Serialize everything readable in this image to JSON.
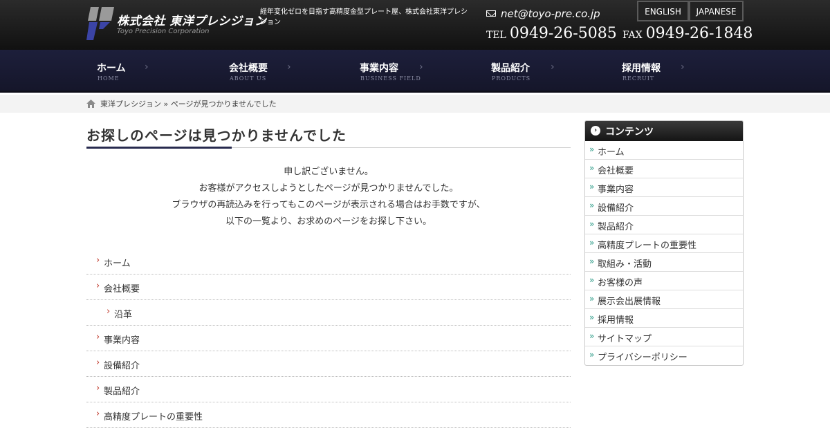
{
  "header": {
    "company_name": "株式会社 東洋プレシジョン",
    "company_name_en": "Toyo Precision Corporation",
    "tagline": "経年変化ゼロを目指す高精度金型プレート屋、株式会社東洋プレシジョン",
    "email": "net@toyo-pre.co.jp",
    "tel_label": "TEL",
    "tel": "0949-26-5085",
    "fax_label": "FAX",
    "fax": "0949-26-1848",
    "lang_en": "ENGLISH",
    "lang_ja": "JAPANESE"
  },
  "nav": [
    {
      "jp": "ホーム",
      "en": "HOME"
    },
    {
      "jp": "会社概要",
      "en": "ABOUT US"
    },
    {
      "jp": "事業内容",
      "en": "BUSINESS FIELD"
    },
    {
      "jp": "製品紹介",
      "en": "PRODUCTS"
    },
    {
      "jp": "採用情報",
      "en": "RECRUIT"
    }
  ],
  "breadcrumb": "東洋プレシジョン » ページが見つかりませんでした",
  "main": {
    "title": "お探しのページは見つかりませんでした",
    "message": [
      "申し訳ございません。",
      "お客様がアクセスしようとしたページが見つかりませんでした。",
      "ブラウザの再読込みを行ってもこのページが表示される場合はお手数ですが、",
      "以下の一覧より、お求めのページをお探し下さい。"
    ],
    "links": [
      "ホーム",
      "会社概要",
      "沿革",
      "事業内容",
      "設備紹介",
      "製品紹介",
      "高精度プレートの重要性"
    ]
  },
  "sidebar": {
    "title": "コンテンツ",
    "items": [
      "ホーム",
      "会社概要",
      "事業内容",
      "設備紹介",
      "製品紹介",
      "高精度プレートの重要性",
      "取組み・活動",
      "お客様の声",
      "展示会出展情報",
      "採用情報",
      "サイトマップ",
      "プライバシーポリシー"
    ]
  },
  "colors": {
    "nav_bg": "#1d1f3b",
    "title_accent": "#272a4e",
    "list_arrow": "#c0392b",
    "side_arrow": "#2b9a86"
  }
}
